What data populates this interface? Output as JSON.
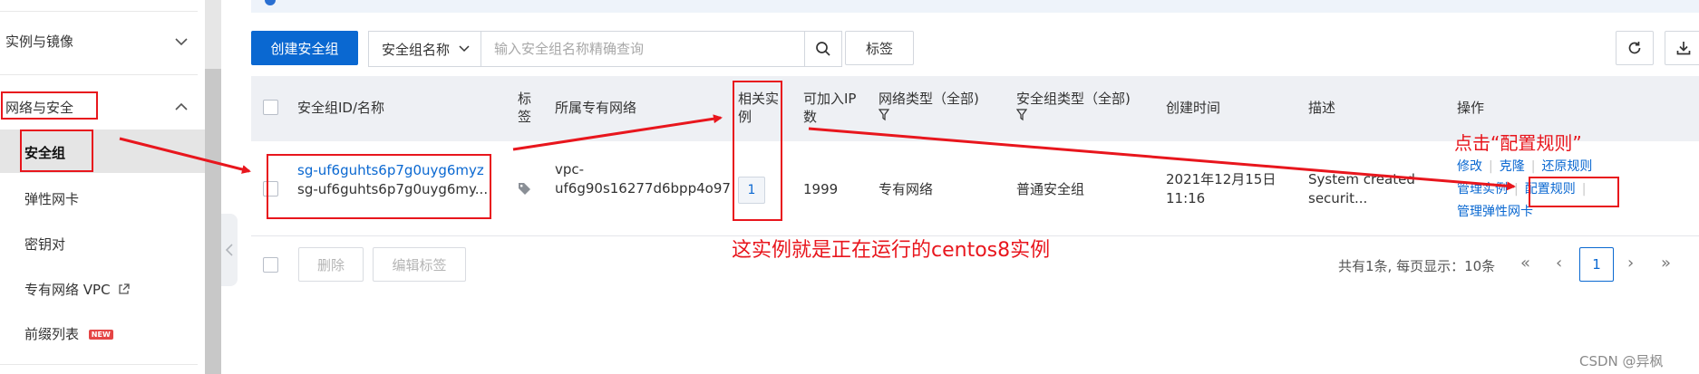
{
  "sidebar": {
    "group_instances": "实例与镜像",
    "group_network": "网络与安全",
    "items": [
      {
        "label": "安全组"
      },
      {
        "label": "弹性网卡"
      },
      {
        "label": "密钥对"
      },
      {
        "label": "专有网络 VPC"
      },
      {
        "label": "前缀列表",
        "badge": "NEW"
      }
    ]
  },
  "toolbar": {
    "create_label": "创建安全组",
    "search_field": "安全组名称",
    "search_placeholder": "输入安全组名称精确查询",
    "tag_label": "标签"
  },
  "table": {
    "headers": {
      "id_name": "安全组ID/名称",
      "tag_line1": "标",
      "tag_line2": "签",
      "vpc": "所属专有网络",
      "instances_line1": "相关实",
      "instances_line2": "例",
      "ip_line1": "可加入IP",
      "ip_line2": "数",
      "net_type": "网络类型（全部)",
      "sg_type": "安全组类型（全部)",
      "created": "创建时间",
      "desc": "描述",
      "ops": "操作"
    },
    "row": {
      "id": "sg-uf6guhts6p7g0uyg6myz",
      "name": "sg-uf6guhts6p7g0uyg6my...",
      "vpc_line1": "vpc-",
      "vpc_line2": "uf6g90s16277d6bpp4o97",
      "instances": "1",
      "ip_count": "1999",
      "net_type": "专有网络",
      "sg_type": "普通安全组",
      "created_line1": "2021年12月15日",
      "created_line2": "11:16",
      "desc_line1": "System created",
      "desc_line2": "securit...",
      "ops": {
        "modify": "修改",
        "clone": "克隆",
        "restore": "还原规则",
        "manage_instances": "管理实例",
        "config_rules": "配置规则",
        "manage_eni": "管理弹性网卡"
      }
    }
  },
  "footer": {
    "delete_label": "删除",
    "edit_tags_label": "编辑标签",
    "page_info": "共有1条, 每页显示：10条",
    "first": "«",
    "prev": "‹",
    "current_page": "1",
    "next": "›",
    "last": "»"
  },
  "annotations": {
    "instance_note": "这实例就是正在运行的centos8实例",
    "click_note": "点击“配置规则”"
  },
  "watermark": "CSDN @异枫",
  "colors": {
    "primary": "#0a68d1",
    "annotation": "#e8161d"
  }
}
